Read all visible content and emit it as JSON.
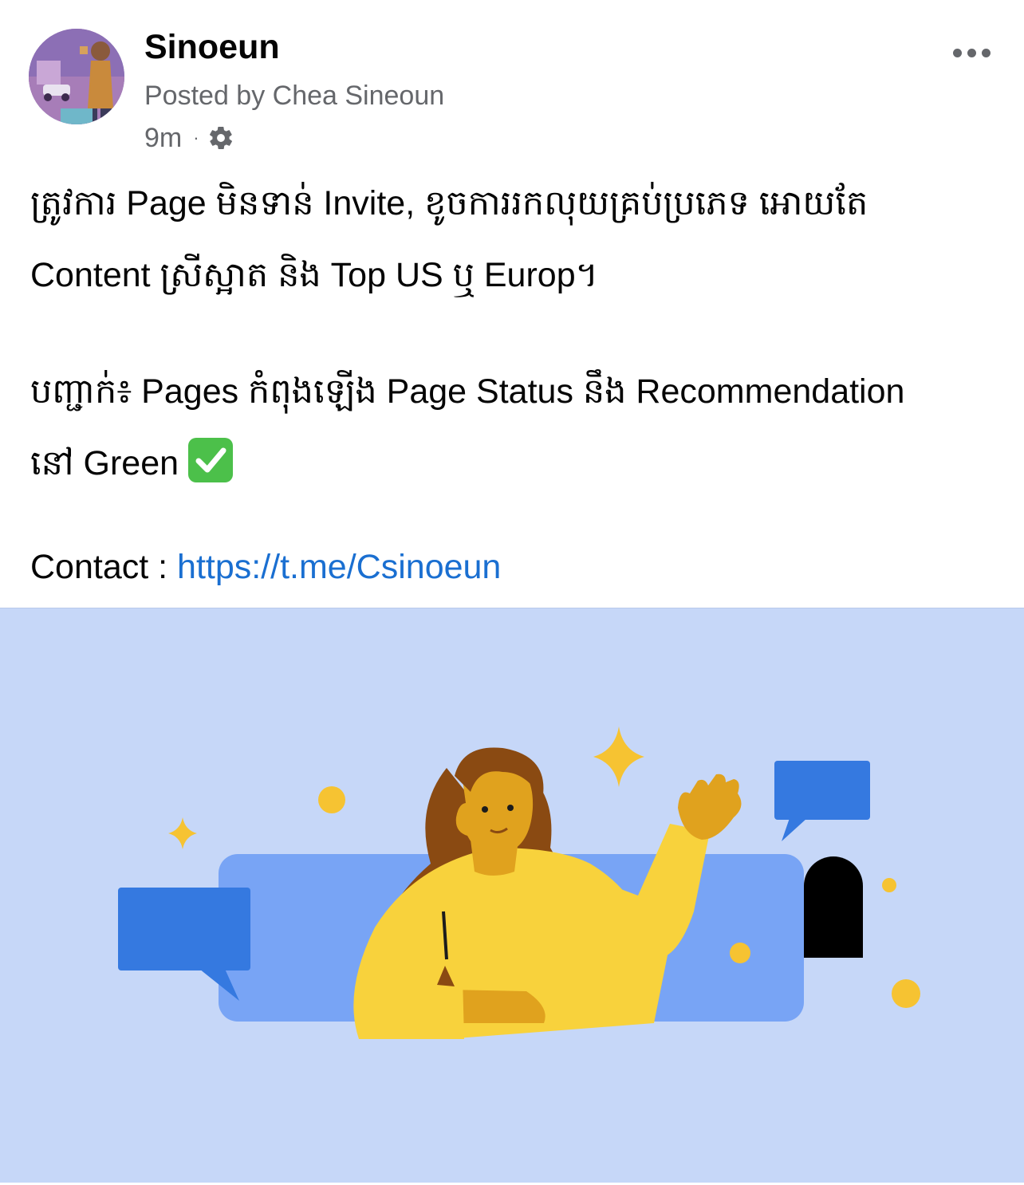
{
  "post": {
    "author_name": "Sinoeun",
    "posted_by": "Posted by Chea Sineoun",
    "time_ago": "9m",
    "separator": "·",
    "privacy_icon": "gear-icon",
    "more_icon": "more-options-icon",
    "body": {
      "line1": "ត្រូវការ Page មិនទាន់ Invite, ខូចការរកលុយគ្រប់ប្រភេទ អោយតែ",
      "line2": "Content ស្រីស្អាត និង Top US ឬ Europ។",
      "line3": "បញ្ជាក់៖ Pages កំពុងឡើង Page Status នឹង Recommendation",
      "line4": "នៅ Green",
      "line4_emoji": "check-mark-button-icon",
      "contact_label": "Contact : ",
      "contact_link": "https://t.me/Csinoeun"
    },
    "image": {
      "description_icon": "woman-waving-illustration",
      "background_color": "#c6d7f8"
    }
  },
  "colors": {
    "link": "#1a6fd1",
    "secondary_text": "#65676b",
    "primary_text": "#050505"
  }
}
